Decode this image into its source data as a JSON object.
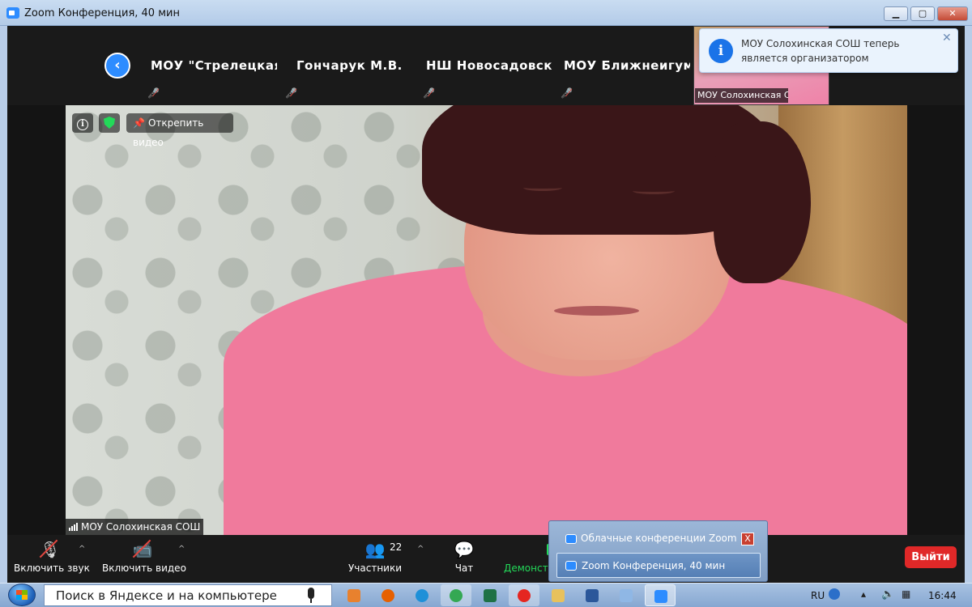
{
  "window": {
    "title": "Zoom Конференция, 40 мин",
    "min_label": "▁",
    "max_label": "▢",
    "close_label": "✕"
  },
  "gallery": {
    "back_label": "‹",
    "thumbnails": [
      {
        "name": "МОУ \"Стрелецкая СОШ\""
      },
      {
        "name": "Гончарук М.В."
      },
      {
        "name": "НШ Новосадовская"
      },
      {
        "name": "МОУ Ближнеигуменская"
      }
    ],
    "self_view": {
      "name": "МОУ Солохинская СОШ"
    }
  },
  "notification": {
    "text": "МОУ Солохинская СОШ теперь является организатором",
    "icon": "i",
    "close": "✕"
  },
  "video": {
    "info_icon": "i",
    "unpin_label": "Открепить видео",
    "pin_glyph": "📌",
    "speaker_name": "МОУ Солохинская СОШ"
  },
  "toolbar": {
    "unmute_label": "Включить звук",
    "start_video_label": "Включить видео",
    "participants_label": "Участники",
    "participants_count": "22",
    "chat_label": "Чат",
    "share_label": "Демонстр",
    "leave_label": "Выйти",
    "caret": "^"
  },
  "taskbar_popup": {
    "items": [
      {
        "label": "Облачные конференции Zoom",
        "close": "X"
      },
      {
        "label": "Zoom Конференция, 40 мин"
      }
    ]
  },
  "taskbar": {
    "search_placeholder": "Поиск в Яндексе и на компьютере",
    "language": "RU",
    "clock": "16:44",
    "colors": {
      "media": "#e8812e",
      "firefox": "#e66000",
      "ie": "#1e90d8",
      "chrome": "#34a853",
      "excel": "#1e7145",
      "yandex": "#e52620",
      "explorer": "#e8c15c",
      "word": "#2b579a",
      "app": "#8fb7e5",
      "zoom": "#2d8cff"
    }
  }
}
